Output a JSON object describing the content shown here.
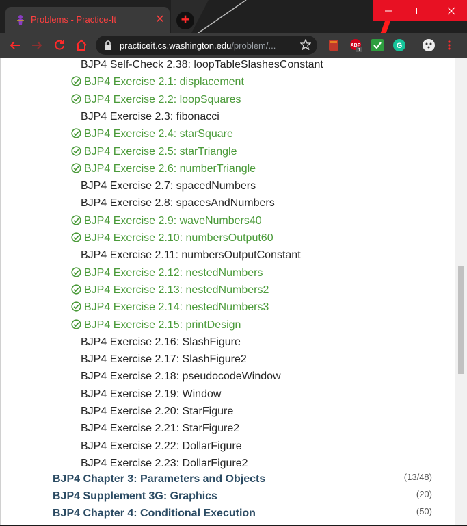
{
  "browser": {
    "tab": {
      "title": "Problems - Practice-It"
    },
    "url": {
      "host": "practiceit.cs.washington.edu",
      "path": "/problem/..."
    }
  },
  "colors": {
    "solved": "#4a9a39",
    "unsolved": "#262626",
    "chapter": "#2b4b63",
    "accent": "#ff2a2a"
  },
  "problems": [
    {
      "label": "BJP4 Self-Check 2.38: loopTableSlashesConstant",
      "solved": false
    },
    {
      "label": "BJP4 Exercise 2.1: displacement",
      "solved": true
    },
    {
      "label": "BJP4 Exercise 2.2: loopSquares",
      "solved": true
    },
    {
      "label": "BJP4 Exercise 2.3: fibonacci",
      "solved": false
    },
    {
      "label": "BJP4 Exercise 2.4: starSquare",
      "solved": true
    },
    {
      "label": "BJP4 Exercise 2.5: starTriangle",
      "solved": true
    },
    {
      "label": "BJP4 Exercise 2.6: numberTriangle",
      "solved": true
    },
    {
      "label": "BJP4 Exercise 2.7: spacedNumbers",
      "solved": false
    },
    {
      "label": "BJP4 Exercise 2.8: spacesAndNumbers",
      "solved": false
    },
    {
      "label": "BJP4 Exercise 2.9: waveNumbers40",
      "solved": true
    },
    {
      "label": "BJP4 Exercise 2.10: numbersOutput60",
      "solved": true
    },
    {
      "label": "BJP4 Exercise 2.11: numbersOutputConstant",
      "solved": false
    },
    {
      "label": "BJP4 Exercise 2.12: nestedNumbers",
      "solved": true
    },
    {
      "label": "BJP4 Exercise 2.13: nestedNumbers2",
      "solved": true
    },
    {
      "label": "BJP4 Exercise 2.14: nestedNumbers3",
      "solved": true
    },
    {
      "label": "BJP4 Exercise 2.15: printDesign",
      "solved": true
    },
    {
      "label": "BJP4 Exercise 2.16: SlashFigure",
      "solved": false
    },
    {
      "label": "BJP4 Exercise 2.17: SlashFigure2",
      "solved": false
    },
    {
      "label": "BJP4 Exercise 2.18: pseudocodeWindow",
      "solved": false
    },
    {
      "label": "BJP4 Exercise 2.19: Window",
      "solved": false
    },
    {
      "label": "BJP4 Exercise 2.20: StarFigure",
      "solved": false
    },
    {
      "label": "BJP4 Exercise 2.21: StarFigure2",
      "solved": false
    },
    {
      "label": "BJP4 Exercise 2.22: DollarFigure",
      "solved": false
    },
    {
      "label": "BJP4 Exercise 2.23: DollarFigure2",
      "solved": false
    }
  ],
  "chapters": [
    {
      "title": "BJP4 Chapter 3: Parameters and Objects",
      "count": "(13/48)"
    },
    {
      "title": "BJP4 Supplement 3G: Graphics",
      "count": "(20)"
    },
    {
      "title": "BJP4 Chapter 4: Conditional Execution",
      "count": "(50)"
    }
  ]
}
